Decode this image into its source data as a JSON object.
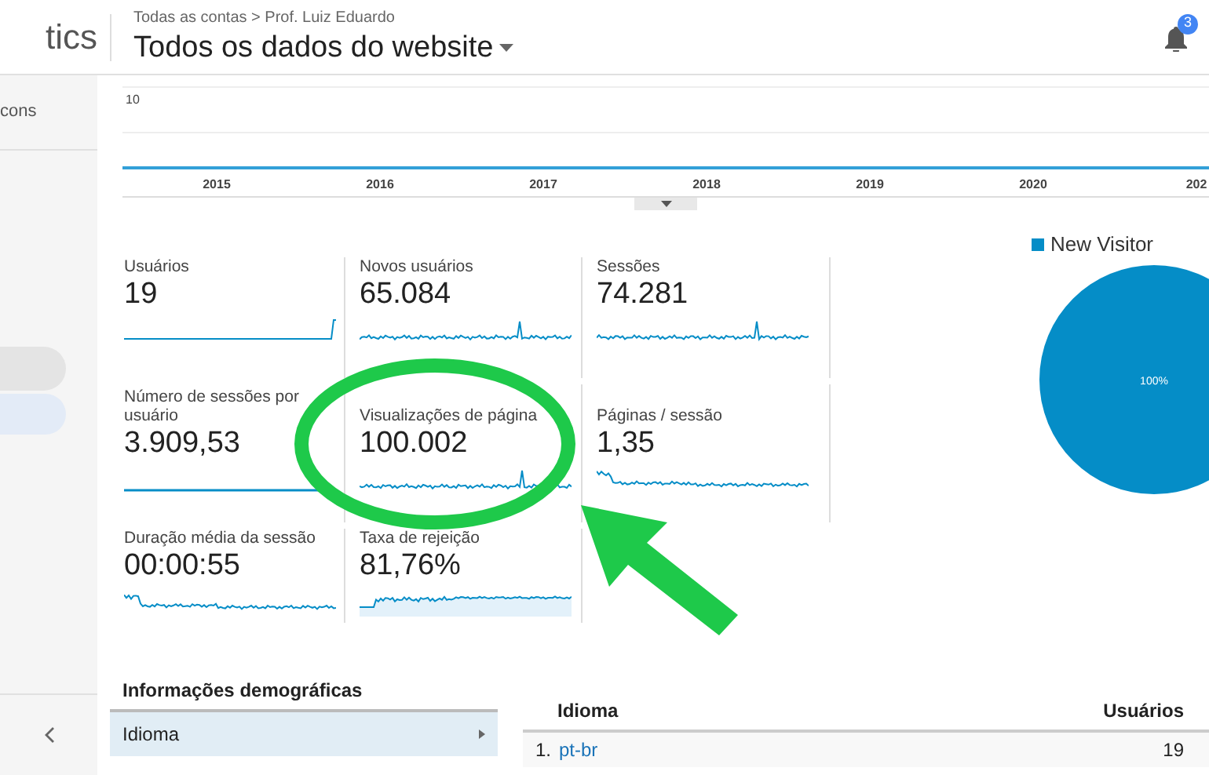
{
  "header": {
    "app_name_fragment": "tics",
    "breadcrumb": "Todas as contas > Prof. Luiz Eduardo",
    "view_title": "Todos os dados do website",
    "notification_count": "3"
  },
  "sidebar": {
    "items": [
      {
        "label": "cons"
      }
    ]
  },
  "overview_chart": {
    "y_tick": "10",
    "x_labels": [
      "2015",
      "2016",
      "2017",
      "2018",
      "2019",
      "2020",
      "202"
    ]
  },
  "metrics": [
    {
      "label": "Usuários",
      "value": "19"
    },
    {
      "label": "Novos usuários",
      "value": "65.084"
    },
    {
      "label": "Sessões",
      "value": "74.281"
    },
    {
      "label": "Número de sessões por usuário",
      "value": "3.909,53"
    },
    {
      "label": "Visualizações de página",
      "value": "100.002"
    },
    {
      "label": "Páginas / sessão",
      "value": "1,35"
    },
    {
      "label": "Duração média da sessão",
      "value": "00:00:55"
    },
    {
      "label": "Taxa de rejeição",
      "value": "81,76%"
    }
  ],
  "user_type_chart": {
    "chart_data": {
      "type": "pie",
      "categories": [
        "New Visitor"
      ],
      "values": [
        100
      ],
      "data_labels": true,
      "value_labels": [
        "100%"
      ]
    }
  },
  "demographics": {
    "title": "Informações demográficas",
    "items": [
      {
        "label": "Idioma",
        "selected": true
      }
    ]
  },
  "language_table": {
    "columns": [
      "Idioma",
      "Usuários"
    ],
    "rows": [
      {
        "rank": "1.",
        "language": "pt-br",
        "users": "19"
      }
    ]
  }
}
